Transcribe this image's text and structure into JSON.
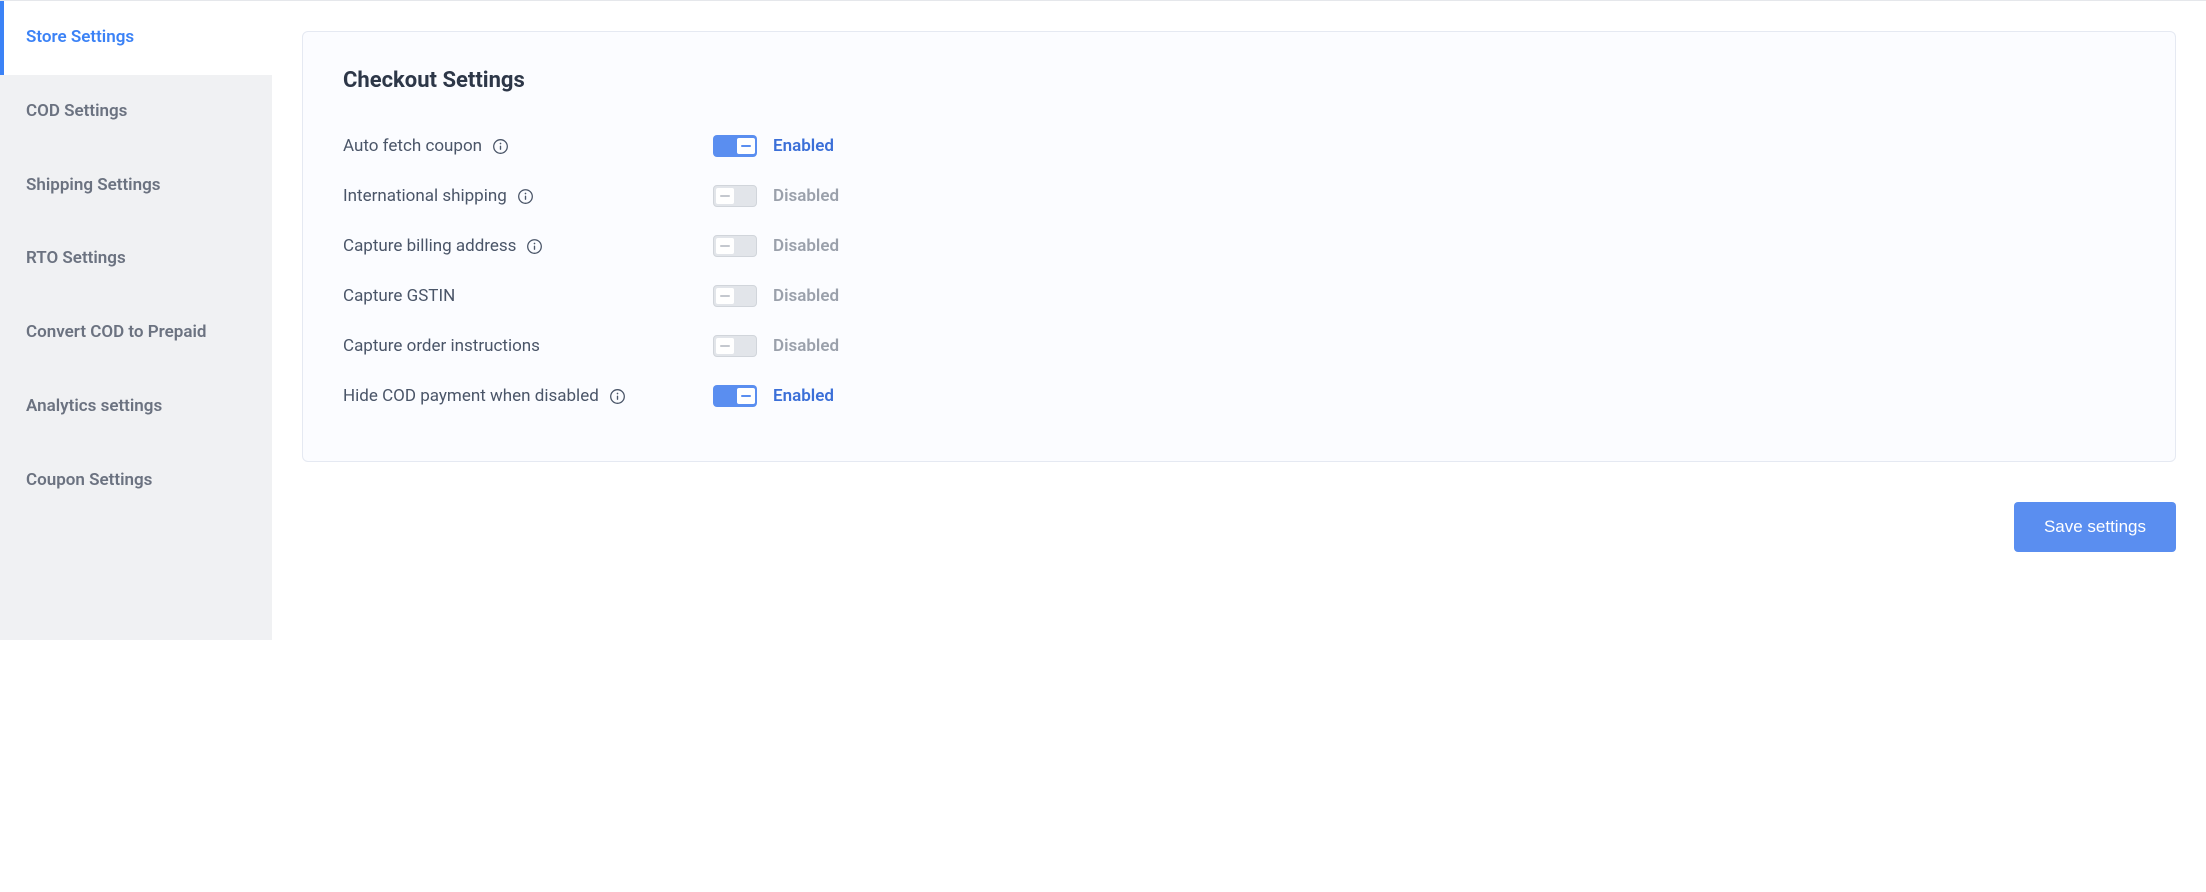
{
  "sidebar": {
    "items": [
      {
        "label": "Store Settings",
        "active": true
      },
      {
        "label": "COD Settings",
        "active": false
      },
      {
        "label": "Shipping Settings",
        "active": false
      },
      {
        "label": "RTO Settings",
        "active": false
      },
      {
        "label": "Convert COD to Prepaid",
        "active": false
      },
      {
        "label": "Analytics settings",
        "active": false
      },
      {
        "label": "Coupon Settings",
        "active": false
      }
    ]
  },
  "card": {
    "title": "Checkout Settings",
    "settings": [
      {
        "label": "Auto fetch coupon",
        "hasInfo": true,
        "enabled": true
      },
      {
        "label": "International shipping",
        "hasInfo": true,
        "enabled": false
      },
      {
        "label": "Capture billing address",
        "hasInfo": true,
        "enabled": false
      },
      {
        "label": "Capture GSTIN",
        "hasInfo": false,
        "enabled": false
      },
      {
        "label": "Capture order instructions",
        "hasInfo": false,
        "enabled": false
      },
      {
        "label": "Hide COD payment when disabled",
        "hasInfo": true,
        "enabled": true
      }
    ]
  },
  "statusLabels": {
    "enabled": "Enabled",
    "disabled": "Disabled"
  },
  "footer": {
    "saveLabel": "Save settings"
  }
}
